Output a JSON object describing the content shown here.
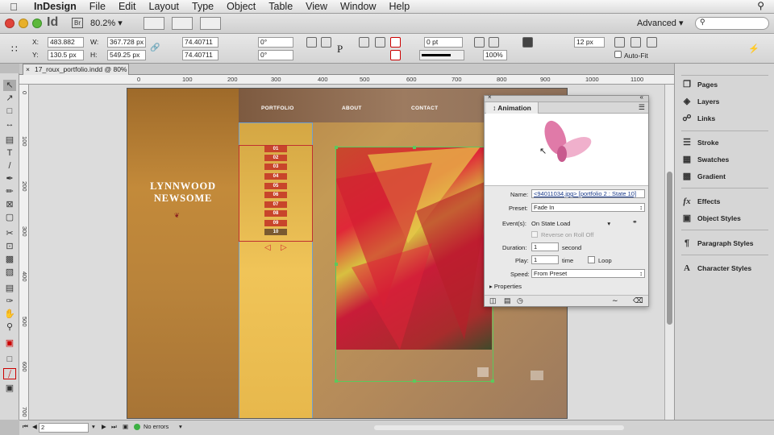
{
  "menubar": {
    "app": "InDesign",
    "items": [
      "File",
      "Edit",
      "Layout",
      "Type",
      "Object",
      "Table",
      "View",
      "Window",
      "Help"
    ]
  },
  "appbar": {
    "logo": "Id",
    "bridge": "Br",
    "zoom": "80.2%",
    "workspace": "Advanced",
    "search_placeholder": ""
  },
  "control": {
    "x_label": "X:",
    "x_value": "483.882 px",
    "y_label": "Y:",
    "y_value": "130.5 px",
    "w_label": "W:",
    "w_value": "367.728 px",
    "h_label": "H:",
    "h_value": "549.25 px",
    "scale_x": "74.40711",
    "scale_y": "74.40711",
    "rotate": "0°",
    "shear": "0°",
    "stroke_weight": "0 pt",
    "opacity": "100%",
    "fit_value": "12 px",
    "autofit_label": "Auto-Fit"
  },
  "document": {
    "tab_title": "17_roux_portfolio.indd @ 80%"
  },
  "ruler_h": [
    "100",
    "0",
    "100",
    "200",
    "300",
    "400",
    "500",
    "600",
    "700",
    "800",
    "900",
    "1000",
    "1100"
  ],
  "ruler_v": [
    "0",
    "100",
    "200",
    "300",
    "400",
    "500",
    "600",
    "700"
  ],
  "page": {
    "nav": [
      "PORTFOLIO",
      "ABOUT",
      "CONTACT"
    ],
    "name_line1": "LYNNWOOD",
    "name_line2": "NEWSOME",
    "numbers": [
      "01",
      "02",
      "03",
      "04",
      "05",
      "06",
      "07",
      "08",
      "09",
      "10"
    ]
  },
  "animation": {
    "title": "Animation",
    "name_label": "Name:",
    "name_value": "<94011034.jpg> [portfolio 2 : State 10]",
    "preset_label": "Preset:",
    "preset_value": "Fade In",
    "events_label": "Event(s):",
    "events_value": "On State Load",
    "reverse_label": "Reverse on Roll Off",
    "duration_label": "Duration:",
    "duration_value": "1",
    "duration_unit": "second",
    "play_label": "Play:",
    "play_value": "1",
    "play_unit": "time",
    "loop_label": "Loop",
    "speed_label": "Speed:",
    "speed_value": "From Preset",
    "properties_label": "Properties"
  },
  "dock": {
    "items": [
      "Pages",
      "Layers",
      "Links",
      "Stroke",
      "Swatches",
      "Gradient",
      "Effects",
      "Object Styles",
      "Paragraph Styles",
      "Character Styles"
    ]
  },
  "status": {
    "page": "2",
    "errors": "No errors"
  }
}
